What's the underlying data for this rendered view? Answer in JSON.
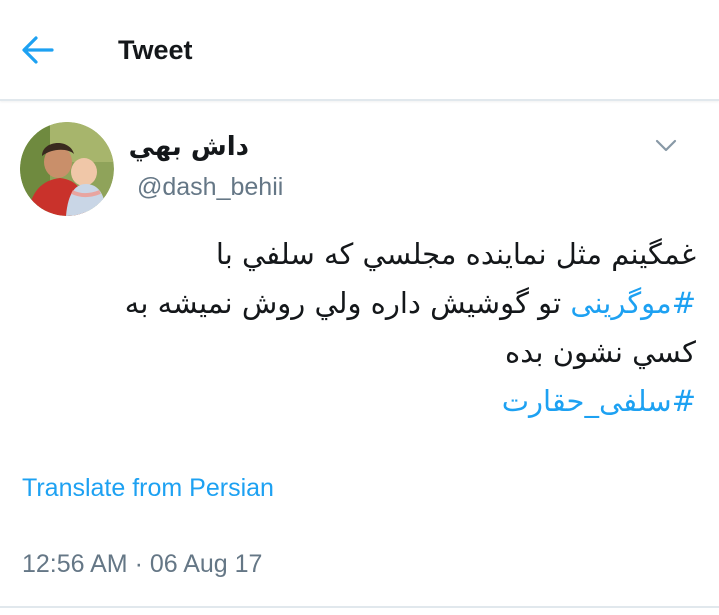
{
  "header": {
    "back_icon": "arrow-left-icon",
    "title": "Tweet"
  },
  "tweet": {
    "author": {
      "display_name": "داش بهي",
      "handle": "@dash_behii"
    },
    "menu_icon": "chevron-down-icon",
    "text": {
      "line1": "غمگینم مثل نماینده مجلسي که سلفي با",
      "line2_hashtag": "#موگرینی",
      "line2_rest": "تو گوشیش داره ولي روش نمیشه به",
      "line3": "کسي نشون بده",
      "line4_hashtag": "#سلفی_حقارت"
    },
    "translate_label": "Translate from Persian",
    "timestamp": "12:56 AM · 06 Aug 17"
  },
  "colors": {
    "accent": "#1da1f2",
    "text": "#14171a",
    "secondary": "#657786",
    "divider": "#e1e8ed"
  }
}
